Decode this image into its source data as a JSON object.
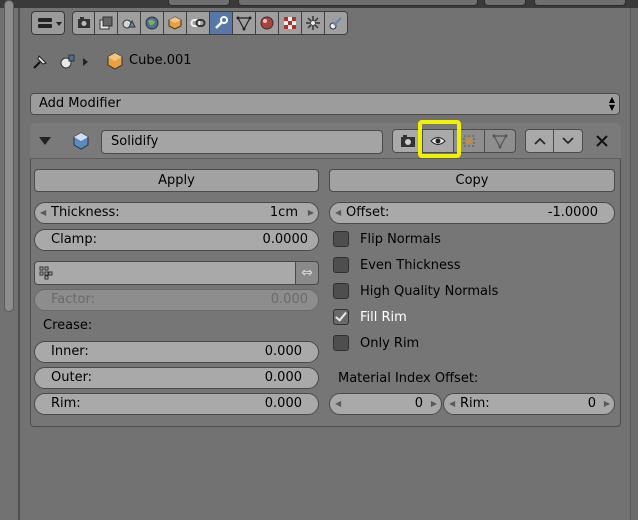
{
  "header": {
    "active_tab": "modifiers",
    "tabs": [
      "render-icon",
      "render-layers-icon",
      "scene-icon",
      "world-icon",
      "object-icon",
      "constraints-icon",
      "modifiers-icon",
      "data-icon",
      "material-icon",
      "texture-icon",
      "particles-icon",
      "physics-icon"
    ]
  },
  "context": {
    "object_name": "Cube.001"
  },
  "add_modifier": {
    "label": "Add Modifier"
  },
  "modifier": {
    "name": "Solidify",
    "apply_label": "Apply",
    "copy_label": "Copy",
    "thickness": {
      "label": "Thickness:",
      "value": "1cm"
    },
    "clamp": {
      "label": "Clamp:",
      "value": "0.0000"
    },
    "offset": {
      "label": "Offset:",
      "value": "-1.0000"
    },
    "vertex_group": {
      "value": ""
    },
    "factor": {
      "label": "Factor:",
      "value": "0.000"
    },
    "crease_heading": "Crease:",
    "inner": {
      "label": "Inner:",
      "value": "0.000"
    },
    "outer": {
      "label": "Outer:",
      "value": "0.000"
    },
    "rim": {
      "label": "Rim:",
      "value": "0.000"
    },
    "options": [
      {
        "label": "Flip Normals",
        "checked": false
      },
      {
        "label": "Even Thickness",
        "checked": false
      },
      {
        "label": "High Quality Normals",
        "checked": false
      },
      {
        "label": "Fill Rim",
        "checked": true
      },
      {
        "label": "Only Rim",
        "checked": false
      }
    ],
    "material_offset_heading": "Material Index Offset:",
    "material_offset": {
      "value": "0"
    },
    "material_rim": {
      "label": "Rim:",
      "value": "0"
    }
  },
  "colors": {
    "highlight": "#f2f200",
    "active_tab": "#5677a8"
  }
}
